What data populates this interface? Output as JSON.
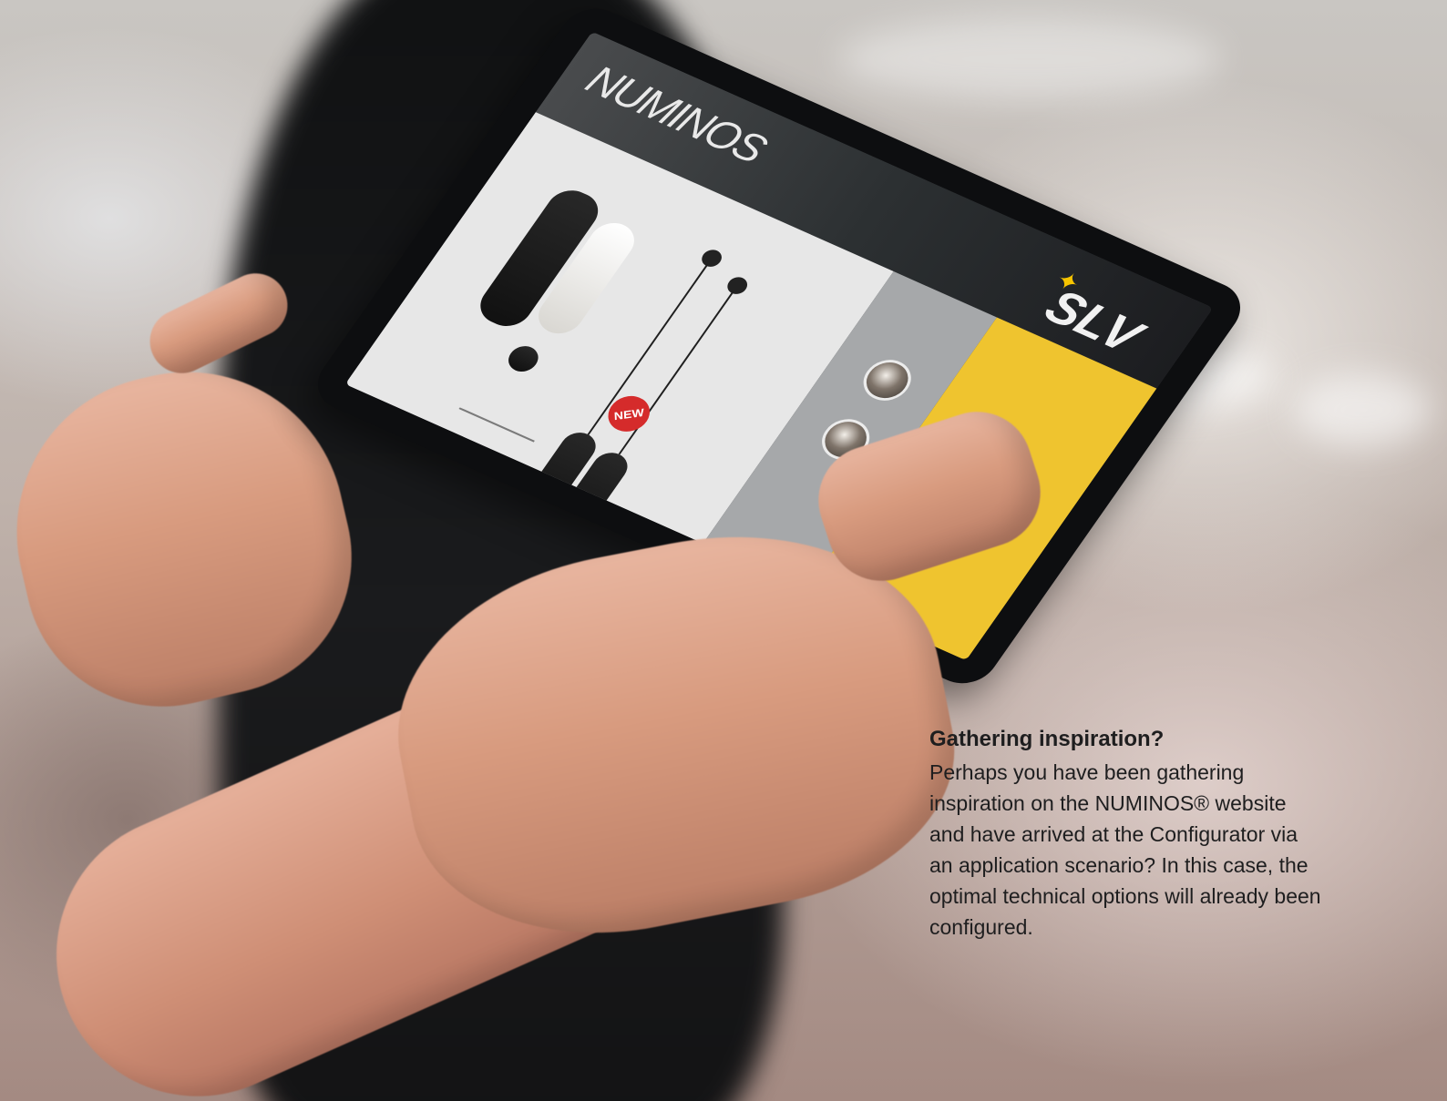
{
  "headline": "Gathering inspiration?",
  "body": "Perhaps you have been gathering inspiration on the NUMINOS® website and have arrived at the Configurator via an application scenario? In this case, the optimal technical options will already been configured.",
  "tablet": {
    "brand_title": "NUMINOS",
    "logo_text": "SLV",
    "badge_text": "NEW"
  },
  "icons": {
    "logo_spark": "lightning-spark-icon"
  },
  "colors": {
    "accent_yellow": "#efc42f",
    "badge_red": "#d52b2b"
  }
}
